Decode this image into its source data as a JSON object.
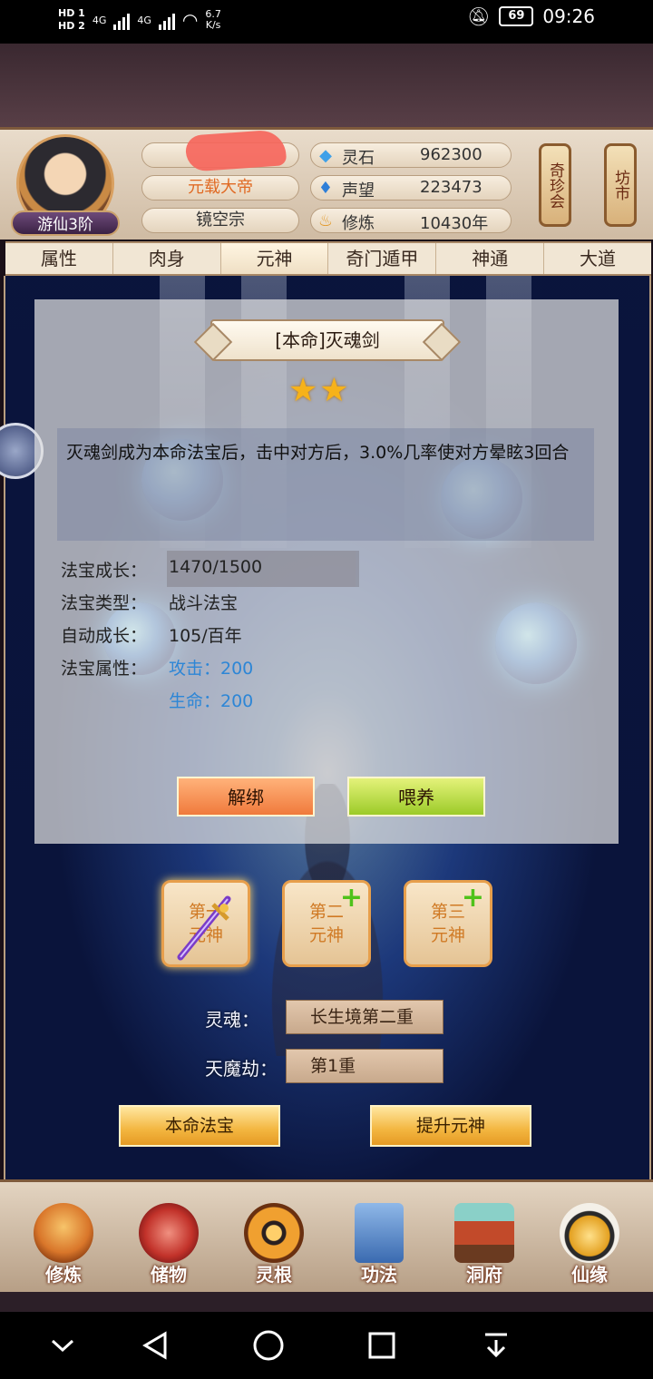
{
  "status_bar": {
    "hd1": "HD 1",
    "hd2": "HD 2",
    "net1": "4G",
    "net2": "4G",
    "speed": "6.7",
    "speed_unit": "K/s",
    "battery": "69",
    "time": "09:26"
  },
  "player": {
    "rank": "游仙3阶",
    "title": "元载大帝",
    "sect": "镜空宗"
  },
  "resources": [
    {
      "icon": "spirit-stone-icon",
      "label": "灵石",
      "value": "962300"
    },
    {
      "icon": "reputation-icon",
      "label": "声望",
      "value": "223473"
    },
    {
      "icon": "cultivation-icon",
      "label": "修炼",
      "value": "10430年"
    }
  ],
  "shortcuts": {
    "treasure_hall": "奇珍会",
    "market": "坊市"
  },
  "tabs": [
    "属性",
    "肉身",
    "元神",
    "奇门遁甲",
    "神通",
    "大道"
  ],
  "active_tab": "元神",
  "artifact": {
    "name": "[本命]灭魂剑",
    "stars": 2,
    "star_glyphs": "★★",
    "description": "灭魂剑成为本命法宝后，击中对方后，3.0%几率使对方晕眩3回合",
    "growth_label": "法宝成长：",
    "growth_value": "1470/1500",
    "growth_fraction": 0.98,
    "type_label": "法宝类型：",
    "type_value": "战斗法宝",
    "auto_label": "自动成长：",
    "auto_value": "105/百年",
    "attr_label": "法宝属性：",
    "attr_attack": "攻击：200",
    "attr_hp": "生命：200",
    "unbind_label": "解绑",
    "feed_label": "喂养"
  },
  "souls": {
    "slot1": "第一元神",
    "slot2_line1": "第二",
    "slot2_line2": "元神",
    "slot3_line1": "第三",
    "slot3_line2": "元神",
    "slot1_line1": "第一",
    "slot1_line2": "元神",
    "plus": "+"
  },
  "realm": {
    "soul_label": "灵魂：",
    "soul_value": "长生境第二重",
    "tribulation_label": "天魔劫：",
    "tribulation_value": "第1重"
  },
  "actions": {
    "natal_treasure": "本命法宝",
    "upgrade_soul": "提升元神"
  },
  "bottom_nav": [
    {
      "label": "修炼",
      "icon": "cultivate-icon"
    },
    {
      "label": "储物",
      "icon": "storage-bag-icon"
    },
    {
      "label": "灵根",
      "icon": "spirit-root-icon"
    },
    {
      "label": "功法",
      "icon": "scripture-icon"
    },
    {
      "label": "洞府",
      "icon": "cave-mansion-icon"
    },
    {
      "label": "仙缘",
      "icon": "immortal-fate-icon"
    }
  ],
  "colors": {
    "title_orange": "#e06a24",
    "attr_blue": "#2d86d6",
    "plus_green": "#4fc21a",
    "star_gold": "#f6b21a"
  }
}
